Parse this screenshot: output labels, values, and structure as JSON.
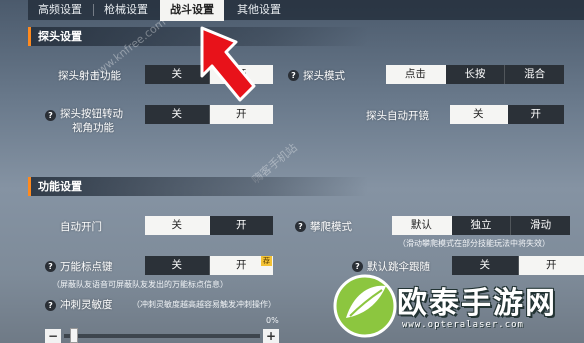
{
  "tabs": [
    {
      "label": "高频设置"
    },
    {
      "label": "枪械设置"
    },
    {
      "label": "战斗设置"
    },
    {
      "label": "其他设置"
    }
  ],
  "peek_section": {
    "title": "探头设置",
    "shoot": {
      "label": "探头射击功能",
      "options": [
        "关",
        "开"
      ]
    },
    "mode": {
      "label": "探头模式",
      "options": [
        "点击",
        "长按",
        "混合"
      ]
    },
    "button_turn": {
      "label_line1": "探头按钮转动",
      "label_line2": "视角功能",
      "options": [
        "关",
        "开"
      ]
    },
    "auto_scope": {
      "label": "探头自动开镜",
      "options": [
        "关",
        "开"
      ]
    }
  },
  "function_section": {
    "title": "功能设置",
    "auto_door": {
      "label": "自动开门",
      "options": [
        "关",
        "开"
      ]
    },
    "climb": {
      "label": "攀爬模式",
      "options": [
        "默认",
        "独立",
        "滑动"
      ],
      "hint": "（滑动攀爬模式在部分技能玩法中将失效）"
    },
    "marker": {
      "label": "万能标点键",
      "options": [
        "关",
        "开"
      ],
      "badge": "荐",
      "hint": "（屏蔽队友语音可屏蔽队友发出的万能标点信息）"
    },
    "parachute": {
      "label": "默认跳伞跟随",
      "options": [
        "关",
        "开"
      ]
    },
    "sprint": {
      "label": "冲刺灵敏度",
      "hint": "（冲刺灵敏度越高越容易触发冲刺操作）",
      "value": "0%",
      "minus": "−",
      "plus": "+"
    }
  },
  "watermarks": [
    "www.knfree.com",
    "嗨客手机站"
  ],
  "logo": {
    "title": "欧泰手游网",
    "url": "www.opteralaser.com"
  },
  "help_glyph": "?",
  "colors": {
    "accent": "#ff8a1e",
    "arrow": "#e8121a",
    "selected": "#f5f5f3",
    "logo_green": "#8cc63f"
  }
}
